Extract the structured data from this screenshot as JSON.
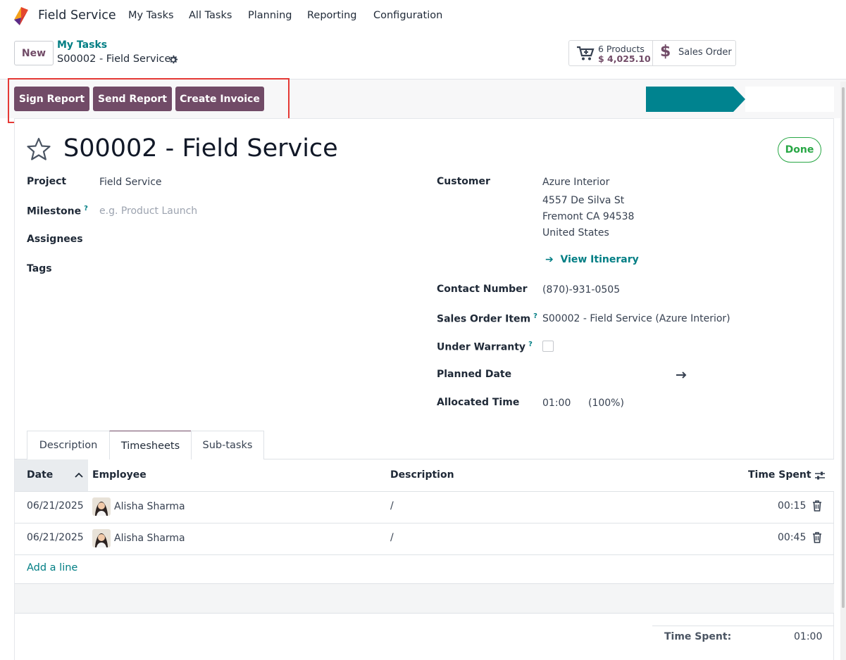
{
  "nav": {
    "app_name": "Field Service",
    "items": [
      "My Tasks",
      "All Tasks",
      "Planning",
      "Reporting",
      "Configuration"
    ]
  },
  "control": {
    "new_label": "New",
    "breadcrumb_parent": "My Tasks",
    "breadcrumb_current": "S00002 - Field Service"
  },
  "smart_buttons": {
    "products_count": "6 Products",
    "products_amount": "$ 4,025.10",
    "sales_order": "Sales Order"
  },
  "actions": {
    "sign_report": "Sign Report",
    "send_report": "Send Report",
    "create_invoice": "Create Invoice"
  },
  "task": {
    "title": "S00002 - Field Service",
    "status": "Done"
  },
  "left_fields": {
    "project_label": "Project",
    "project_value": "Field Service",
    "milestone_label": "Milestone",
    "milestone_placeholder": "e.g. Product Launch",
    "assignees_label": "Assignees",
    "tags_label": "Tags"
  },
  "right_fields": {
    "customer_label": "Customer",
    "customer_name": "Azure Interior",
    "address_line1": "4557 De Silva St",
    "address_line2": "Fremont CA 94538",
    "address_line3": "United States",
    "view_itinerary": "View Itinerary",
    "contact_label": "Contact Number",
    "contact_value": "(870)-931-0505",
    "so_item_label": "Sales Order Item",
    "so_item_value": "S00002 - Field Service (Azure Interior)",
    "warranty_label": "Under Warranty",
    "planned_label": "Planned Date",
    "allocated_label": "Allocated Time",
    "allocated_value": "01:00",
    "allocated_pct": "(100%)"
  },
  "help_mark": "?",
  "tabs": [
    "Description",
    "Timesheets",
    "Sub-tasks"
  ],
  "timesheet": {
    "columns": [
      "Date",
      "Employee",
      "Description",
      "Time Spent"
    ],
    "rows": [
      {
        "date": "06/21/2025",
        "employee": "Alisha Sharma",
        "description": "/",
        "time": "00:15"
      },
      {
        "date": "06/21/2025",
        "employee": "Alisha Sharma",
        "description": "/",
        "time": "00:45"
      }
    ],
    "add_line": "Add a line",
    "total_label": "Time Spent:",
    "total_value": "01:00"
  },
  "colors": {
    "brand": "#714b67",
    "teal": "#017e84",
    "success": "#28a745",
    "stage_active": "#00838f",
    "highlight": "#e53935"
  }
}
